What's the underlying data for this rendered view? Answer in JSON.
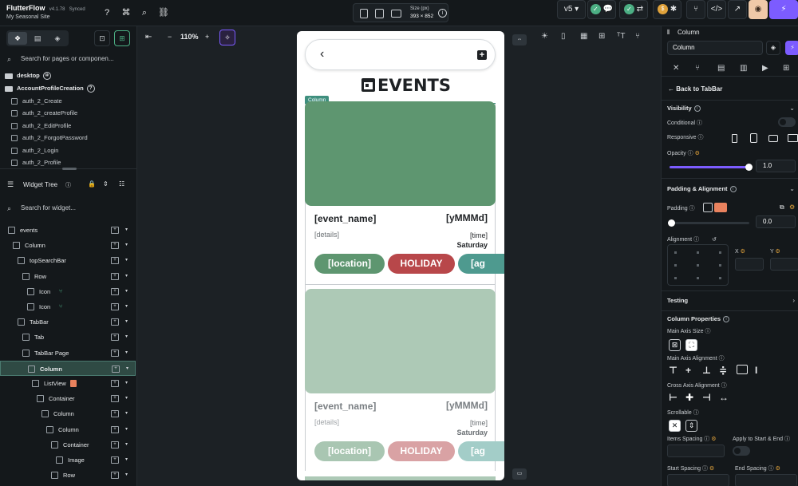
{
  "app": {
    "brand": "FlutterFlow",
    "version": "v4.1.78",
    "sync_status": "Synced",
    "site_name": "My Seasonal Site"
  },
  "topbar": {
    "size_label": "Size (px)",
    "size_value": "393 × 852",
    "version_select": "v5"
  },
  "left_panel": {
    "page_search_placeholder": "Search for pages or componen...",
    "folders": [
      {
        "name": "desktop"
      },
      {
        "name": "AccountProfileCreation"
      }
    ],
    "pages": [
      "auth_2_Create",
      "auth_2_createProfile",
      "auth_2_EditProfile",
      "auth_2_ForgotPassword",
      "auth_2_Login",
      "auth_2_Profile"
    ],
    "widget_tree_title": "Widget Tree",
    "widget_search_placeholder": "Search for widget...",
    "tree": [
      {
        "label": "events",
        "indent": 0
      },
      {
        "label": "Column",
        "indent": 1
      },
      {
        "label": "topSearchBar",
        "indent": 2
      },
      {
        "label": "Row",
        "indent": 3
      },
      {
        "label": "Icon",
        "indent": 4
      },
      {
        "label": "Icon",
        "indent": 4
      },
      {
        "label": "TabBar",
        "indent": 2
      },
      {
        "label": "Tab",
        "indent": 3
      },
      {
        "label": "TabBar Page",
        "indent": 3
      },
      {
        "label": "Column",
        "indent": 4,
        "selected": true
      },
      {
        "label": "ListView",
        "indent": 5
      },
      {
        "label": "Container",
        "indent": 6
      },
      {
        "label": "Column",
        "indent": 7
      },
      {
        "label": "Column",
        "indent": 8
      },
      {
        "label": "Container",
        "indent": 9
      },
      {
        "label": "Image",
        "indent": 10
      },
      {
        "label": "Row",
        "indent": 9
      }
    ]
  },
  "canvas": {
    "zoom": "110%",
    "page_title": "EVENTS",
    "selection_tag": "Column",
    "cards": [
      {
        "image_color": "#5e9670",
        "event_name": "[event_name]",
        "date": "[yMMMd]",
        "details": "[details]",
        "time": "[time]",
        "day": "Saturday",
        "chips": [
          {
            "label": "[location]",
            "color": "#5e9670"
          },
          {
            "label": "HOLIDAY",
            "color": "#b8474a"
          },
          {
            "label": "[ag",
            "color": "#4e9a8f"
          }
        ]
      },
      {
        "image_color": "#adc9b6",
        "event_name": "[event_name]",
        "date": "[yMMMd]",
        "details": "[details]",
        "time": "[time]",
        "day": "Saturday",
        "chips": [
          {
            "label": "[location]",
            "color": "#a9c6b2"
          },
          {
            "label": "HOLIDAY",
            "color": "#d9a2a4"
          },
          {
            "label": "[ag",
            "color": "#a3cdc8"
          }
        ]
      }
    ]
  },
  "right_panel": {
    "widget_type": "Column",
    "widget_name": "Column",
    "back_label": "Back to TabBar",
    "visibility": {
      "title": "Visibility",
      "conditional": "Conditional",
      "responsive": "Responsive",
      "opacity": "Opacity",
      "opacity_value": "1.0",
      "opacity_fraction": 1.0
    },
    "padding_alignment": {
      "title": "Padding & Alignment",
      "padding": "Padding",
      "padding_value": "0.0",
      "alignment": "Alignment",
      "x": "X",
      "y": "Y"
    },
    "testing": "Testing",
    "column_properties": {
      "title": "Column Properties",
      "main_axis_size": "Main Axis Size",
      "main_axis_alignment": "Main Axis Alignment",
      "cross_axis_alignment": "Cross Axis Alignment",
      "scrollable": "Scrollable",
      "items_spacing": "Items Spacing",
      "apply_start_end": "Apply to Start & End",
      "start_spacing": "Start Spacing",
      "end_spacing": "End Spacing"
    }
  }
}
